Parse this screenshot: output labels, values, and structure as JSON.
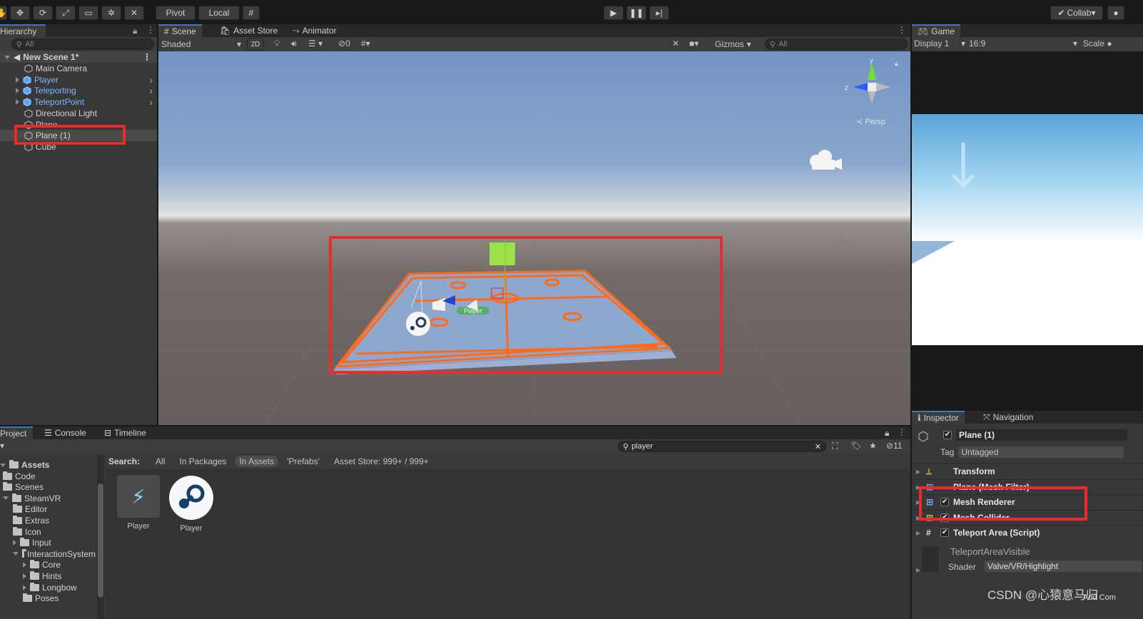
{
  "toolbar": {
    "pivot": "Pivot",
    "local": "Local",
    "collab": "Collab"
  },
  "hierarchy": {
    "tab": "Hierarchy",
    "search_placeholder": "All",
    "scene_name": "New Scene 1*",
    "items": [
      {
        "label": "Main Camera"
      },
      {
        "label": "Player"
      },
      {
        "label": "Teleporting"
      },
      {
        "label": "TeleportPoint"
      },
      {
        "label": "Directional Light"
      },
      {
        "label": "Plane"
      },
      {
        "label": "Plane (1)"
      },
      {
        "label": "Cube"
      }
    ]
  },
  "scene_tabs": {
    "scene": "Scene",
    "asset_store": "Asset Store",
    "animator": "Animator"
  },
  "scene_toolbar": {
    "shading": "Shaded",
    "mode_2d": "2D",
    "hidden_count": "0",
    "gizmos": "Gizmos",
    "search_placeholder": "All"
  },
  "scene_view": {
    "persp_label": "Persp",
    "player_tag": "Player",
    "axis_y": "y",
    "axis_z": "z"
  },
  "game_view": {
    "tab": "Game",
    "display": "Display 1",
    "aspect": "16:9",
    "scale": "Scale"
  },
  "project": {
    "tabs": [
      "Project",
      "Console",
      "Timeline"
    ],
    "search_value": "player",
    "filter_count": "11",
    "search_label": "Search:",
    "filters": [
      "All",
      "In Packages",
      "In Assets",
      "'Prefabs'",
      "Asset Store: 999+ / 999+"
    ],
    "tree": [
      {
        "label": "Assets",
        "depth": 0,
        "open": true,
        "bold": true
      },
      {
        "label": "Code",
        "depth": 1
      },
      {
        "label": "Scenes",
        "depth": 1
      },
      {
        "label": "SteamVR",
        "depth": 1,
        "open": true
      },
      {
        "label": "Editor",
        "depth": 2
      },
      {
        "label": "Extras",
        "depth": 2
      },
      {
        "label": "Icon",
        "depth": 2
      },
      {
        "label": "Input",
        "depth": 2,
        "collapsed": true
      },
      {
        "label": "InteractionSystem",
        "depth": 2,
        "open": true
      },
      {
        "label": "Core",
        "depth": 3,
        "collapsed": true
      },
      {
        "label": "Hints",
        "depth": 3,
        "collapsed": true
      },
      {
        "label": "Longbow",
        "depth": 3,
        "collapsed": true
      },
      {
        "label": "Poses",
        "depth": 3
      }
    ],
    "assets": [
      {
        "label": "Player",
        "icon": "teleport-prefab-icon"
      },
      {
        "label": "Player",
        "icon": "steam-logo-icon"
      }
    ]
  },
  "inspector": {
    "tabs": [
      "Inspector",
      "Navigation"
    ],
    "object_name": "Plane (1)",
    "tag_label": "Tag",
    "tag_value": "Untagged",
    "components": [
      {
        "label": "Transform"
      },
      {
        "label": "Plane (Mesh Filter)"
      },
      {
        "label": "Mesh Renderer"
      },
      {
        "label": "Mesh Collider"
      },
      {
        "label": "Teleport Area (Script)"
      }
    ],
    "material_name": "TeleportAreaVisible",
    "shader_label": "Shader",
    "shader_value": "Valve/VR/Highlight",
    "add_component": "Add Com"
  },
  "watermark": "CSDN @心猿意马归",
  "colors": {
    "highlight_red": "#ea2b2b",
    "teleport_orange": "#ff6a1a",
    "link_blue": "#7bb5ff",
    "sky_top": "#7596c4",
    "ground": "#6e6663"
  }
}
